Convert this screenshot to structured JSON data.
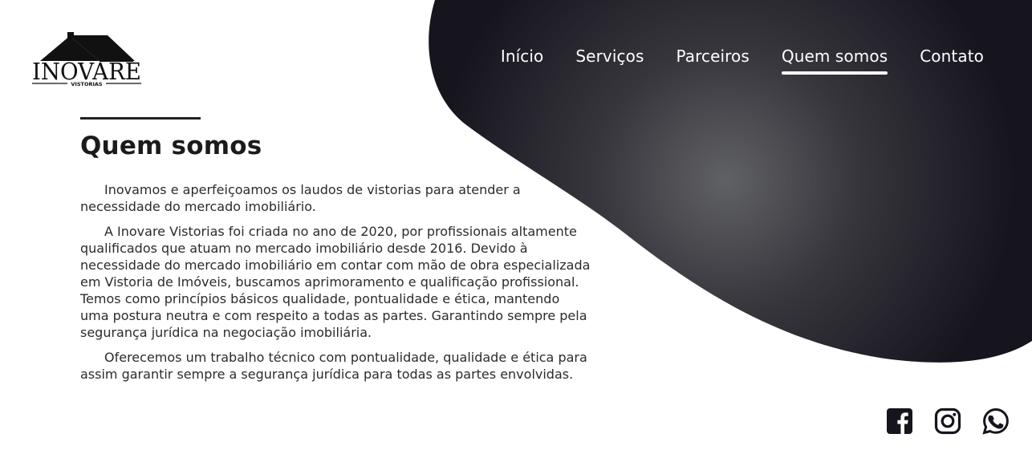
{
  "brand": {
    "name": "INOVARE",
    "subtitle": "VISTORIAS"
  },
  "nav": {
    "items": [
      {
        "label": "Início"
      },
      {
        "label": "Serviços"
      },
      {
        "label": "Parceiros"
      },
      {
        "label": "Quem somos",
        "active": true
      },
      {
        "label": "Contato"
      }
    ]
  },
  "about": {
    "title": "Quem somos",
    "paragraphs": [
      "Inovamos e aperfeiçoamos os laudos de vistorias para atender a necessidade do mercado imobiliário.",
      "A Inovare Vistorias foi criada no ano de 2020, por profissionais altamente qualificados que atuam no mercado imobiliário desde 2016. Devido à necessidade do mercado imobiliário em contar com mão de obra especializada em Vistoria de Imóveis, buscamos aprimoramento e qualificação profissional. Temos como princípios básicos qualidade, pontualidade e ética, mantendo uma postura neutra e com respeito a todas as partes. Garantindo sempre pela segurança jurídica na negociação imobiliária.",
      "Oferecemos um trabalho técnico com pontualidade, qualidade e ética para assim garantir sempre a segurança jurídica para todas as partes envolvidas."
    ]
  },
  "social": {
    "icons": [
      "facebook-icon",
      "instagram-icon",
      "whatsapp-icon"
    ]
  },
  "colors": {
    "dark": "#16141d",
    "blob_highlight": "#5f6064",
    "text": "#2b2b2b",
    "white": "#ffffff"
  }
}
